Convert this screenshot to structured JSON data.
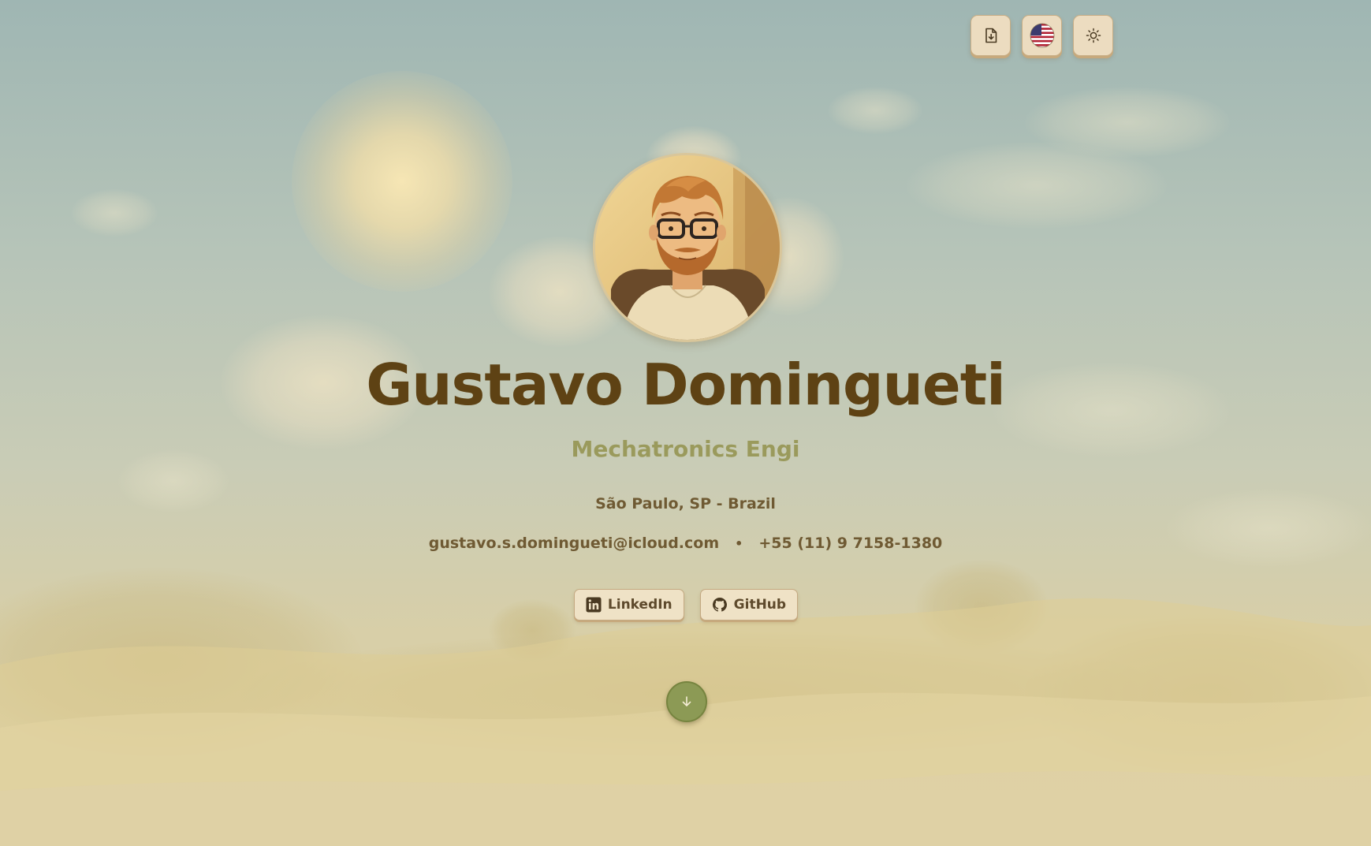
{
  "controls": {
    "download_label": "Download CV",
    "language_label": "Language: English",
    "theme_label": "Toggle theme"
  },
  "profile": {
    "name": "Gustavo Domingueti",
    "role": "Mechatronics Engi",
    "location": "São Paulo, SP - Brazil",
    "email": "gustavo.s.domingueti@icloud.com",
    "separator": "•",
    "phone": "+55 (11) 9 7158-1380"
  },
  "socials": {
    "linkedin_label": "LinkedIn",
    "github_label": "GitHub"
  },
  "icons": {
    "download": "file-download-icon",
    "language": "us-flag-icon",
    "theme": "sun-icon",
    "linkedin": "linkedin-icon",
    "github": "github-icon",
    "scroll": "arrow-down-icon"
  },
  "colors": {
    "name": "#5e4214",
    "role": "#9a9a5c",
    "text": "#6f5a33",
    "button_bg": "#ecdcc0",
    "scroll_button": "#8c9a55"
  }
}
